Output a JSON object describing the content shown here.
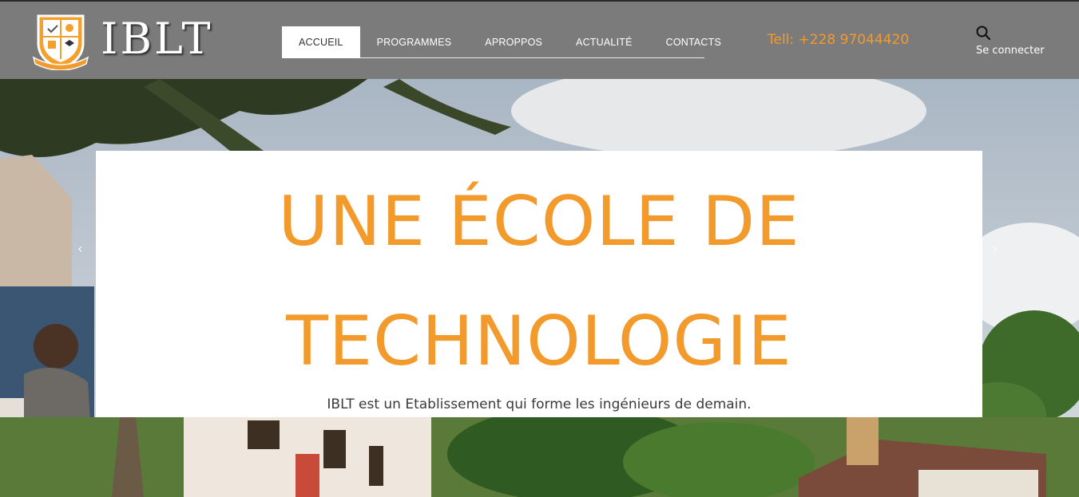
{
  "header": {
    "brand": "IBLT",
    "logo_text": "IBLT",
    "nav": [
      {
        "label": "ACCUEIL",
        "active": true
      },
      {
        "label": "PROGRAMMES",
        "active": false
      },
      {
        "label": "APROPPOS",
        "active": false
      },
      {
        "label": "ACTUALITÉ",
        "active": false
      },
      {
        "label": "CONTACTS",
        "active": false
      }
    ],
    "phone": "Tell: +228 97044420",
    "search_icon": "search-icon",
    "login_label": "Se connecter"
  },
  "hero": {
    "headline": "UNE ÉCOLE DE TECHNOLOGIE",
    "subtitle": "IBLT est un Etablissement qui forme les ingénieurs de demain.",
    "prev_arrow": "‹",
    "next_arrow": "›"
  },
  "colors": {
    "accent": "#f39a2c",
    "header_bg": "#7b7b7b",
    "card_bg": "#ffffff"
  }
}
